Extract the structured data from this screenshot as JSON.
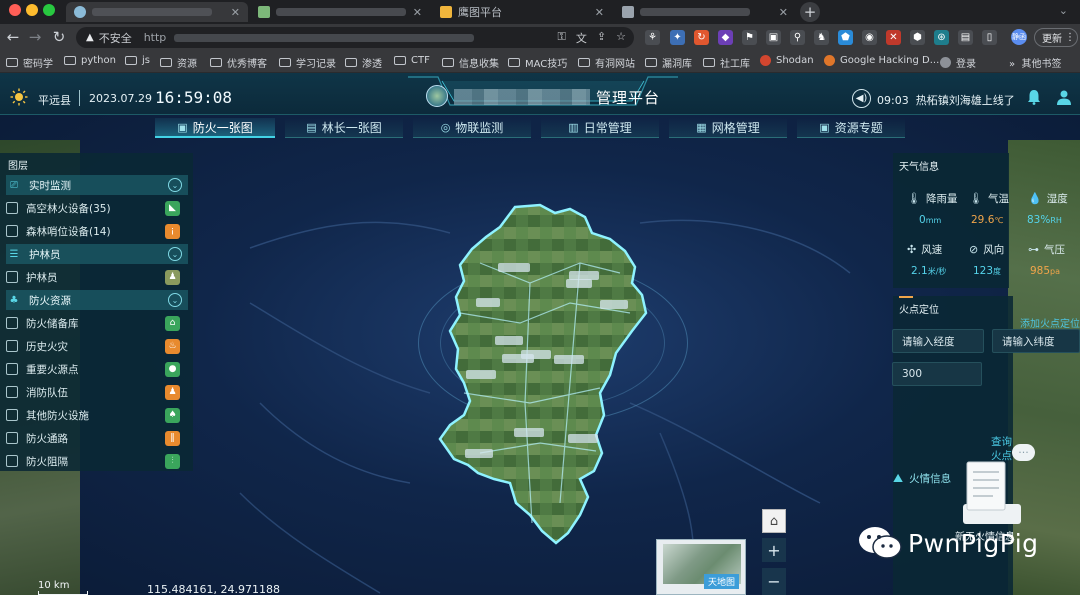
{
  "browser": {
    "tabs": [
      {
        "title": "",
        "blurred": true
      },
      {
        "title": "",
        "blurred": true
      },
      {
        "title": "鹰图平台",
        "blurred": false
      },
      {
        "title": "",
        "blurred": true
      }
    ],
    "address_bar": {
      "security_label": "不安全",
      "url_prefix": "http"
    },
    "update_button": "更新",
    "profile_badge": "静函",
    "bookmarks": [
      "密码学",
      "python",
      "js",
      "资源",
      "优秀博客",
      "学习记录",
      "渗透",
      "CTF",
      "信息收集",
      "MAC技巧",
      "有洞网站",
      "漏洞库",
      "社工库",
      "Shodan",
      "Google Hacking D...",
      "登录"
    ],
    "bookmarks_more": "其他书签"
  },
  "header": {
    "county": "平远县",
    "date": "2023.07.29",
    "time": "16:59:08",
    "platform_title_suffix": "管理平台",
    "notice_time": "09:03",
    "notice_text": "热柘镇刘海雄上线了"
  },
  "nav_tabs": [
    {
      "label": "防火一张图",
      "active": true,
      "icon": "map-icon"
    },
    {
      "label": "林长一张图",
      "active": false,
      "icon": "person-card-icon"
    },
    {
      "label": "物联监测",
      "active": false,
      "icon": "sensor-icon"
    },
    {
      "label": "日常管理",
      "active": false,
      "icon": "clipboard-icon"
    },
    {
      "label": "网格管理",
      "active": false,
      "icon": "grid-icon"
    },
    {
      "label": "资源专题",
      "active": false,
      "icon": "resource-icon"
    }
  ],
  "layers": {
    "title": "图层",
    "rows": [
      {
        "type": "category",
        "label": "实时监测",
        "icon": "monitor-icon"
      },
      {
        "type": "item",
        "label": "高空林火设备(35)",
        "badge_color": "#3aa55c",
        "icon": "camera-icon"
      },
      {
        "type": "item",
        "label": "森林哨位设备(14)",
        "badge_color": "#e88a2e",
        "icon": "torch-icon"
      },
      {
        "type": "category",
        "label": "护林员",
        "icon": "ranger-list-icon"
      },
      {
        "type": "item",
        "label": "护林员",
        "badge_color": "#8a9a5e",
        "icon": "ranger-icon"
      },
      {
        "type": "category",
        "label": "防火资源",
        "icon": "tree-icon"
      },
      {
        "type": "item",
        "label": "防火储备库",
        "badge_color": "#3aa55c",
        "icon": "warehouse-icon"
      },
      {
        "type": "item",
        "label": "历史火灾",
        "badge_color": "#e88a2e",
        "icon": "fire-icon"
      },
      {
        "type": "item",
        "label": "重要火源点",
        "badge_color": "#3aa55c",
        "icon": "pin-icon"
      },
      {
        "type": "item",
        "label": "消防队伍",
        "badge_color": "#e88a2e",
        "icon": "team-icon"
      },
      {
        "type": "item",
        "label": "其他防火设施",
        "badge_color": "#3aa55c",
        "icon": "facility-icon"
      },
      {
        "type": "item",
        "label": "防火通路",
        "badge_color": "#e88a2e",
        "icon": "road-icon"
      },
      {
        "type": "item",
        "label": "防火阻隔",
        "badge_color": "#3aa55c",
        "icon": "barrier-icon"
      }
    ]
  },
  "weather": {
    "title": "天气信息",
    "items": [
      {
        "label": "降雨量",
        "value": "0",
        "unit": "mm",
        "color": "#55d3ea",
        "icon": "rain-gauge-icon"
      },
      {
        "label": "气温",
        "value": "29.6",
        "unit": "℃",
        "color": "#f0a54a",
        "icon": "thermometer-icon"
      },
      {
        "label": "湿度",
        "value": "83%",
        "unit": "RH",
        "color": "#55d3ea",
        "icon": "droplet-icon"
      },
      {
        "label": "风速",
        "value": "2.1",
        "unit": "米/秒",
        "color": "#55d3ea",
        "icon": "fan-icon"
      },
      {
        "label": "风向",
        "value": "123",
        "unit": "度",
        "color": "#55d3ea",
        "icon": "compass-icon"
      },
      {
        "label": "气压",
        "value": "985",
        "unit": "pa",
        "color": "#f0a54a",
        "icon": "pressure-icon"
      }
    ]
  },
  "fire_locate": {
    "title": "火点定位",
    "longitude_placeholder": "请输入经度",
    "latitude_placeholder": "请输入纬度",
    "radius_value": "300",
    "query_label": "查询火点",
    "add_fire_label": "添加火点定位",
    "fire_info_label": "火情信息"
  },
  "map": {
    "scale_label": "10 km",
    "coordinates": "115.484161, 24.971188",
    "basemap_label": "天地图",
    "region_labels": 13
  },
  "new_fire": {
    "label": "新无火情信息"
  },
  "watermark": "PwnPigPig"
}
